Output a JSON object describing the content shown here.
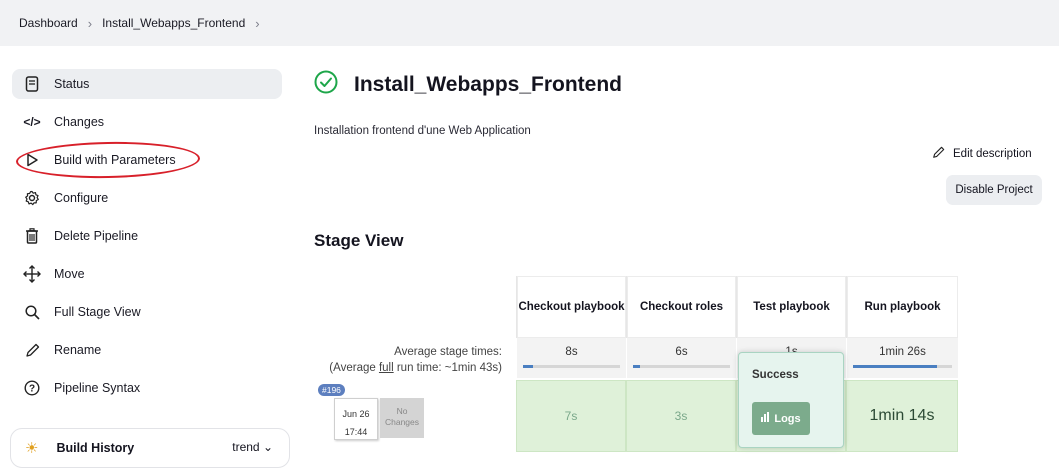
{
  "breadcrumb": {
    "items": [
      "Dashboard",
      "Install_Webapps_Frontend"
    ]
  },
  "sidebar": {
    "items": [
      {
        "label": "Status",
        "icon": "document-icon"
      },
      {
        "label": "Changes",
        "icon": "code-icon"
      },
      {
        "label": "Build with Parameters",
        "icon": "play-icon"
      },
      {
        "label": "Configure",
        "icon": "gear-icon"
      },
      {
        "label": "Delete Pipeline",
        "icon": "trash-icon"
      },
      {
        "label": "Move",
        "icon": "move-icon"
      },
      {
        "label": "Full Stage View",
        "icon": "search-icon"
      },
      {
        "label": "Rename",
        "icon": "pencil-icon"
      },
      {
        "label": "Pipeline Syntax",
        "icon": "help-icon"
      }
    ],
    "build_history": {
      "label": "Build History",
      "trend": "trend"
    }
  },
  "main": {
    "title": "Install_Webapps_Frontend",
    "description": "Installation frontend d'une Web Application",
    "edit_description": "Edit description",
    "disable_project": "Disable Project",
    "stage_view_title": "Stage View"
  },
  "stage_view": {
    "stages": [
      "Checkout playbook",
      "Checkout roles",
      "Test playbook",
      "Run playbook"
    ],
    "avg_label_line1": "Average stage times:",
    "avg_label_line2_prefix": "(Average ",
    "avg_label_link": "full",
    "avg_label_line2_suffix": " run time: ~1min 43s)",
    "avg_times": [
      "8s",
      "6s",
      "1s",
      "1min 26s"
    ],
    "avg_fill": [
      0.1,
      0.07,
      0.02,
      0.85
    ],
    "run": {
      "build": "#196",
      "date": "Jun 26",
      "time": "17:44",
      "changes": "No Changes",
      "times": [
        "7s",
        "3s",
        "",
        "1min 14s"
      ]
    },
    "popup": {
      "title": "Success",
      "logs": "Logs"
    }
  },
  "colors": {
    "success_bg": "#dff1d9",
    "accent": "#d8202a",
    "bar": "#4a7fc1"
  }
}
